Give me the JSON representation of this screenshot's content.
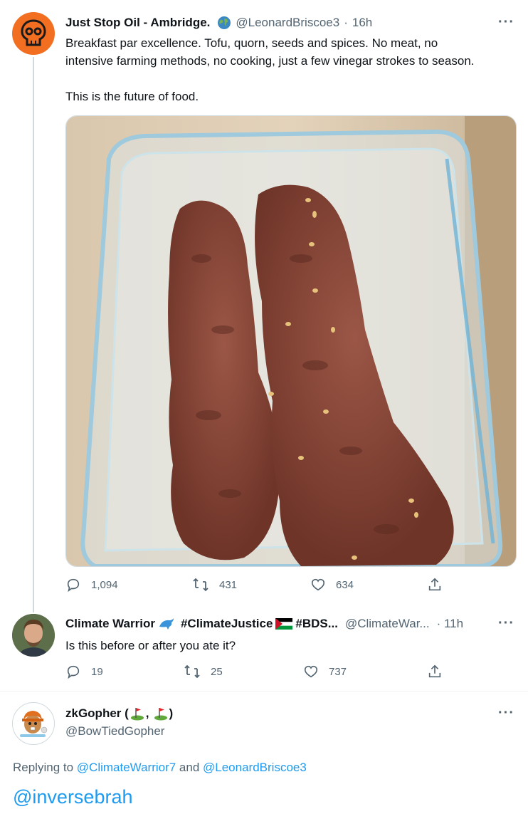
{
  "tweet1": {
    "author_name": "Just Stop Oil - Ambridge.",
    "handle": "@LeonardBriscoe3",
    "time": "16h",
    "text_line1": "Breakfast par excellence. Tofu, quorn, seeds and spices. No meat, no",
    "text_line2": "intensive farming methods, no cooking, just a few vinegar strokes to season.",
    "text_line3": "This is the future of food.",
    "replies": "1,094",
    "retweets": "431",
    "likes": "634"
  },
  "tweet2": {
    "author_name": "Climate Warrior",
    "tags": "#ClimateJustice",
    "tags2": "#BDS...",
    "handle": "@ClimateWar...",
    "time": "· 11h",
    "text": "Is this before or after you ate it?",
    "replies": "19",
    "retweets": "25",
    "likes": "737"
  },
  "tweet3": {
    "author_name": "zkGopher (",
    "author_name_mid": ",",
    "author_name_end": ")",
    "handle": "@BowTiedGopher",
    "replying_prefix": "Replying to ",
    "replying_user1": "@ClimateWarrior7",
    "replying_and": " and ",
    "replying_user2": "@LeonardBriscoe3",
    "text": "@inversebrah"
  },
  "more_glyph": "···",
  "icons": [
    "skull-logo-icon",
    "globe-icon",
    "reply-icon",
    "retweet-icon",
    "like-icon",
    "share-icon",
    "dolphin-icon",
    "palestine-flag-icon",
    "golf-flag-icon"
  ]
}
